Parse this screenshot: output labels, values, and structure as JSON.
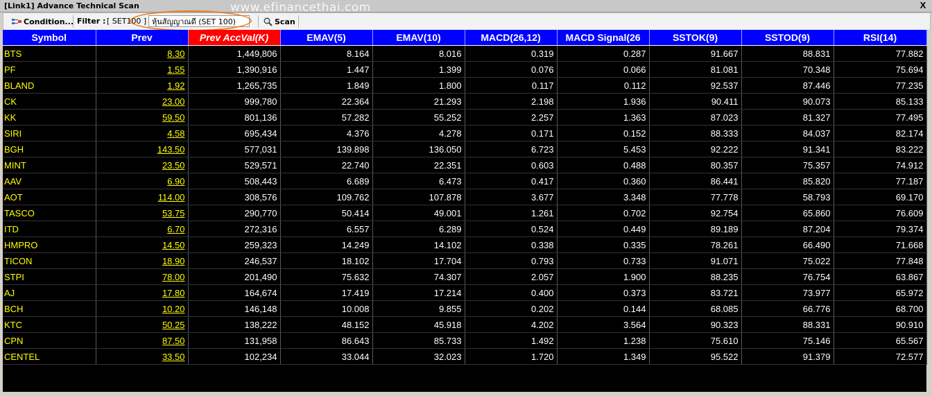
{
  "window": {
    "title": "[Link1] Advance Technical Scan",
    "close_label": "X"
  },
  "watermark": "www.efinancethai.com",
  "toolbar": {
    "condition_label": "Condition...",
    "filter_label": "Filter :",
    "filter_value": "[ SET100 ]",
    "dropdown_value": "หุ้นสัญญาณดี (SET 100)",
    "scan_label": "Scan"
  },
  "table": {
    "columns": [
      "Symbol",
      "Prev",
      "Prev AccVal(K)",
      "EMAV(5)",
      "EMAV(10)",
      "MACD(26,12)",
      "MACD Signal(26",
      "SSTOK(9)",
      "SSTOD(9)",
      "RSI(14)"
    ],
    "sorted_column": 2,
    "rows": [
      [
        "BTS",
        "8.30",
        "1,449,806",
        "8.164",
        "8.016",
        "0.319",
        "0.287",
        "91.667",
        "88.831",
        "77.882"
      ],
      [
        "PF",
        "1.55",
        "1,390,916",
        "1.447",
        "1.399",
        "0.076",
        "0.066",
        "81.081",
        "70.348",
        "75.694"
      ],
      [
        "BLAND",
        "1.92",
        "1,265,735",
        "1.849",
        "1.800",
        "0.117",
        "0.112",
        "92.537",
        "87.446",
        "77.235"
      ],
      [
        "CK",
        "23.00",
        "999,780",
        "22.364",
        "21.293",
        "2.198",
        "1.936",
        "90.411",
        "90.073",
        "85.133"
      ],
      [
        "KK",
        "59.50",
        "801,136",
        "57.282",
        "55.252",
        "2.257",
        "1.363",
        "87.023",
        "81.327",
        "77.495"
      ],
      [
        "SIRI",
        "4.58",
        "695,434",
        "4.376",
        "4.278",
        "0.171",
        "0.152",
        "88.333",
        "84.037",
        "82.174"
      ],
      [
        "BGH",
        "143.50",
        "577,031",
        "139.898",
        "136.050",
        "6.723",
        "5.453",
        "92.222",
        "91.341",
        "83.222"
      ],
      [
        "MINT",
        "23.50",
        "529,571",
        "22.740",
        "22.351",
        "0.603",
        "0.488",
        "80.357",
        "75.357",
        "74.912"
      ],
      [
        "AAV",
        "6.90",
        "508,443",
        "6.689",
        "6.473",
        "0.417",
        "0.360",
        "86.441",
        "85.820",
        "77.187"
      ],
      [
        "AOT",
        "114.00",
        "308,576",
        "109.762",
        "107.878",
        "3.677",
        "3.348",
        "77.778",
        "58.793",
        "69.170"
      ],
      [
        "TASCO",
        "53.75",
        "290,770",
        "50.414",
        "49.001",
        "1.261",
        "0.702",
        "92.754",
        "65.860",
        "76.609"
      ],
      [
        "ITD",
        "6.70",
        "272,316",
        "6.557",
        "6.289",
        "0.524",
        "0.449",
        "89.189",
        "87.204",
        "79.374"
      ],
      [
        "HMPRO",
        "14.50",
        "259,323",
        "14.249",
        "14.102",
        "0.338",
        "0.335",
        "78.261",
        "66.490",
        "71.668"
      ],
      [
        "TICON",
        "18.90",
        "246,537",
        "18.102",
        "17.704",
        "0.793",
        "0.733",
        "91.071",
        "75.022",
        "77.848"
      ],
      [
        "STPI",
        "78.00",
        "201,490",
        "75.632",
        "74.307",
        "2.057",
        "1.900",
        "88.235",
        "76.754",
        "63.867"
      ],
      [
        "AJ",
        "17.80",
        "164,674",
        "17.419",
        "17.214",
        "0.400",
        "0.373",
        "83.721",
        "73.977",
        "65.972"
      ],
      [
        "BCH",
        "10.20",
        "146,148",
        "10.008",
        "9.855",
        "0.202",
        "0.144",
        "68.085",
        "66.776",
        "68.700"
      ],
      [
        "KTC",
        "50.25",
        "138,222",
        "48.152",
        "45.918",
        "4.202",
        "3.564",
        "90.323",
        "88.331",
        "90.910"
      ],
      [
        "CPN",
        "87.50",
        "131,958",
        "86.643",
        "85.733",
        "1.492",
        "1.238",
        "75.610",
        "75.146",
        "65.567"
      ],
      [
        "CENTEL",
        "33.50",
        "102,234",
        "33.044",
        "32.023",
        "1.720",
        "1.349",
        "95.522",
        "91.379",
        "72.577"
      ]
    ]
  }
}
